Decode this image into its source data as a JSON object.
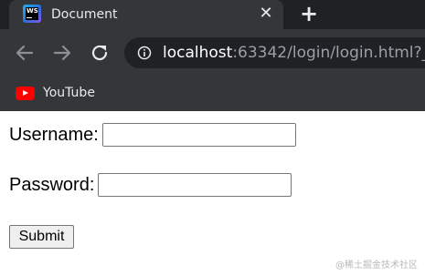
{
  "browser": {
    "tab": {
      "title": "Document",
      "favicon": "webstorm-logo-icon",
      "close_glyph": "✕"
    },
    "new_tab_glyph": "+",
    "toolbar": {
      "back_icon": "arrow-left-icon",
      "forward_icon": "arrow-right-icon",
      "reload_icon": "reload-icon",
      "info_icon": "info-icon"
    },
    "address": {
      "host": "localhost",
      "rest": ":63342/login/login.html?_"
    },
    "bookmarks": [
      {
        "label": "YouTube",
        "icon": "youtube-icon"
      }
    ],
    "colors": {
      "tabstrip": "#202124",
      "toolbar": "#35363a",
      "omnibox": "#202124",
      "text": "#e8eaed",
      "url_dim": "#9aa0a6"
    }
  },
  "form": {
    "username_label": "Username:",
    "username_value": "",
    "password_label": "Password:",
    "password_value": "",
    "submit_label": "Submit"
  },
  "watermark": "@稀土掘金技术社区"
}
